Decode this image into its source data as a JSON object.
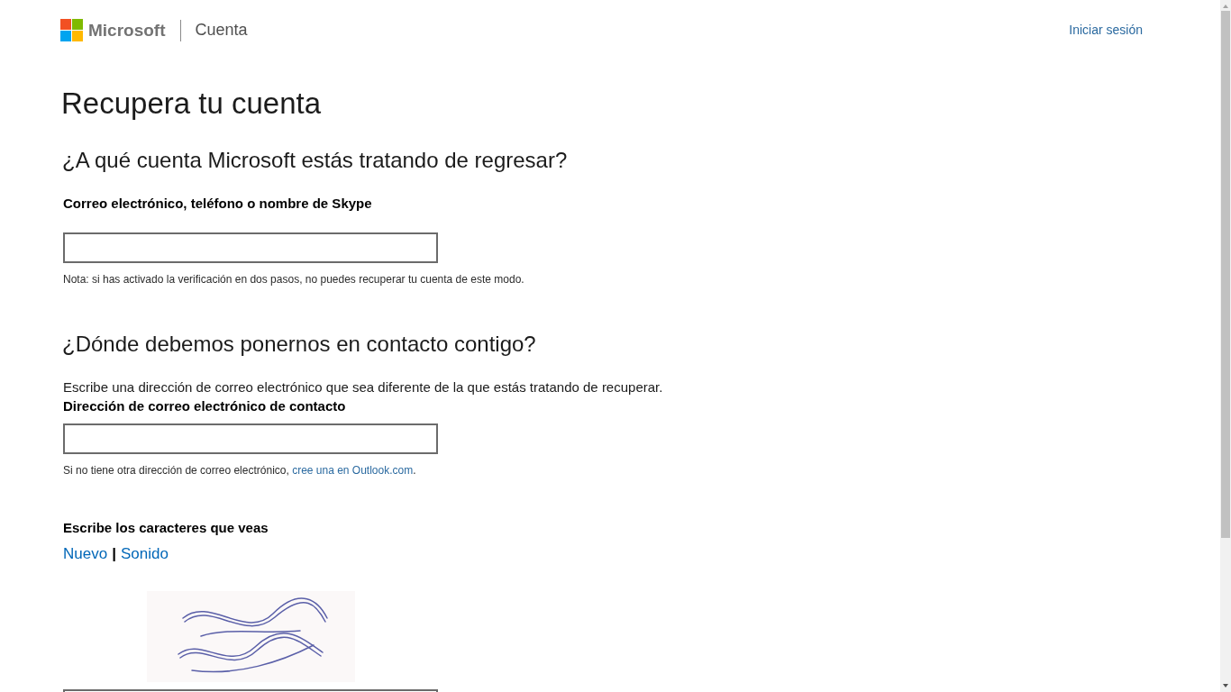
{
  "header": {
    "brand": "Microsoft",
    "section": "Cuenta",
    "sign_in": "Iniciar sesión"
  },
  "page_title": "Recupera tu cuenta",
  "account_section": {
    "heading": "¿A qué cuenta Microsoft estás tratando de regresar?",
    "field_label": "Correo electrónico, teléfono o nombre de Skype",
    "note": "Nota: si has activado la verificación en dos pasos, no puedes recuperar tu cuenta de este modo."
  },
  "contact_section": {
    "heading": "¿Dónde debemos ponernos en contacto contigo?",
    "instructions": "Escribe una dirección de correo electrónico que sea diferente de la que estás tratando de recuperar.",
    "field_label": "Dirección de correo electrónico de contacto",
    "note_start": "Si no tiene otra dirección de correo electrónico, ",
    "note_link": "cree una en Outlook.com",
    "note_end": "."
  },
  "captcha": {
    "label": "Escribe los caracteres que veas",
    "links": [
      "Nuevo",
      "Sonido"
    ],
    "separator": "|"
  }
}
